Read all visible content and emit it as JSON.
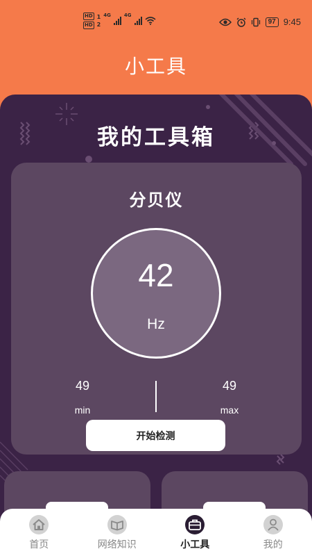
{
  "status_bar": {
    "hd_top": "HD",
    "hd_bottom": "HD",
    "sim1": "1",
    "sim2": "2",
    "network1": "4G",
    "network2": "4G",
    "battery": "97",
    "time": "9:45"
  },
  "app_title": "小工具",
  "panel": {
    "heading": "我的工具箱"
  },
  "decibel_card": {
    "title": "分贝仪",
    "value": "42",
    "unit": "Hz",
    "min_value": "49",
    "min_label": "min",
    "max_value": "49",
    "max_label": "max",
    "start_button": "开始检测"
  },
  "tab_bar": {
    "tabs": [
      {
        "label": "首页",
        "icon": "home-icon",
        "active": false
      },
      {
        "label": "网络知识",
        "icon": "book-icon",
        "active": false
      },
      {
        "label": "小工具",
        "icon": "toolbox-icon",
        "active": true
      },
      {
        "label": "我的",
        "icon": "profile-icon",
        "active": false
      }
    ]
  },
  "colors": {
    "header": "#f57a4a",
    "panel": "#3b2346",
    "card": "#5c4761",
    "dial": "#7b6880",
    "tab_bar": "#ffffff"
  }
}
